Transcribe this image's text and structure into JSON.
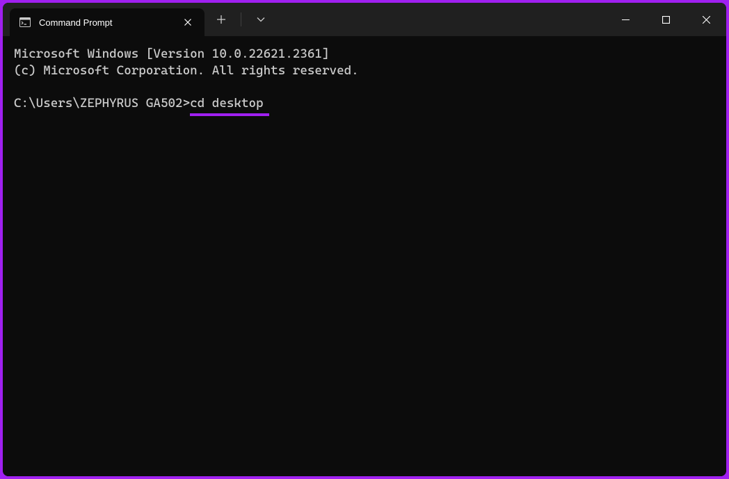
{
  "tab": {
    "title": "Command Prompt"
  },
  "terminal": {
    "line1": "Microsoft Windows [Version 10.0.22621.2361]",
    "line2": "(c) Microsoft Corporation. All rights reserved.",
    "prompt": "C:\\Users\\ZEPHYRUS GA502>",
    "command": "cd desktop"
  },
  "colors": {
    "accent": "#a020f0"
  }
}
